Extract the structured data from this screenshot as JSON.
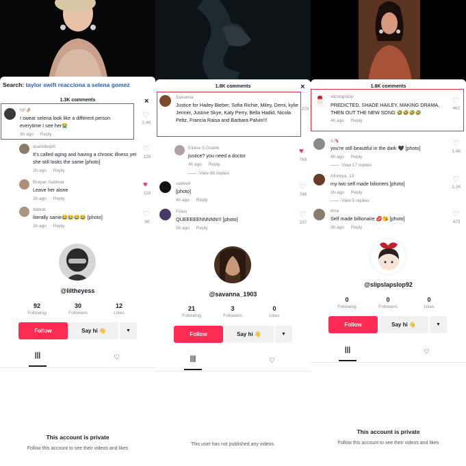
{
  "panels": [
    {
      "search_label": "Search:",
      "search_query": "taylor swift reacciona a selena gomez",
      "comments_header": "1.3K comments",
      "close_icon": "×",
      "comments": [
        {
          "name": "NF🤌🏼",
          "text": "I swear selena look like a different person everytime I see her😭",
          "time": "3h ago",
          "reply": "Reply",
          "likes": "2.4K",
          "liked": false,
          "highlighted": true,
          "avatar_color": "#3a3a3a"
        },
        {
          "name": "acandleqirll",
          "text": "It's called aging and having a chronic illness yet she still looks the same [photo]",
          "time": "2h ago",
          "reply": "Reply",
          "likes": "129",
          "liked": false,
          "avatar_color": "#8a7a6a"
        },
        {
          "name": "Brayan Saldivar",
          "text": "Leave her alone",
          "time": "3h ago",
          "reply": "Reply",
          "likes": "118",
          "liked": true,
          "avatar_color": "#b08f7a"
        },
        {
          "name": "dabrat",
          "text": "literally same😂😂😂😂 [photo]",
          "time": "3h ago",
          "reply": "Reply",
          "likes": "96",
          "liked": false,
          "avatar_color": "#a99580"
        }
      ],
      "profile": {
        "handle": "@liltheyess",
        "stats": [
          {
            "n": "92",
            "l": "Following"
          },
          {
            "n": "30",
            "l": "Followers"
          },
          {
            "n": "12",
            "l": "Likes"
          }
        ],
        "follow": "Follow",
        "say_hi": "Say hi 👋",
        "more": "▼",
        "tab_grid": "|||",
        "tab_liked": "♡",
        "empty_title": "This account is private",
        "empty_sub": "Follow this account to see their videos and likes"
      }
    },
    {
      "comments_header": "1.8K comments",
      "close_icon": "×",
      "comments": [
        {
          "name": "Savanna",
          "text": "Justice for Hailey Bieber, Sofia Richie, Miley, Demi, kylie Jenner, Justine Skye, Katy Perry, Bella Hadid, Nicola Peltz, Francia Raisa and Barbara Palvin!!!",
          "time": "",
          "reply": "",
          "likes": "270",
          "liked": false,
          "highlighted": true,
          "avatar_color": "#7a4a2a"
        },
        {
          "name": "Eliane.S.Duarte",
          "text": "justice? you need a doctor",
          "time": "4h ago",
          "reply": "Reply",
          "likes": "769",
          "liked": true,
          "avatar_color": "#b0a0a8",
          "view_replies": "View 88 replies"
        },
        {
          "name": "sadewii",
          "text": "[photo]",
          "time": "4h ago",
          "reply": "Reply",
          "likes": "746",
          "liked": false,
          "avatar_color": "#111111"
        },
        {
          "name": "Fideo",
          "text": "QUEEEEENNNNN!!! [photo]",
          "time": "5h ago",
          "reply": "Reply",
          "likes": "237",
          "liked": false,
          "avatar_color": "#4a3a6a"
        }
      ],
      "profile": {
        "handle": "@savanna_1903",
        "stats": [
          {
            "n": "21",
            "l": "Following"
          },
          {
            "n": "3",
            "l": "Followers"
          },
          {
            "n": "0",
            "l": "Likes"
          }
        ],
        "follow": "Follow",
        "say_hi": "Say hi 👋",
        "more": "▼",
        "tab_grid": "|||",
        "tab_liked": "♡",
        "empty_title": "",
        "empty_sub": "This user has not published any videos."
      }
    },
    {
      "comments_header": "1.8K comments",
      "comments": [
        {
          "name": "slipslapslop",
          "text": "PREDICTED. SHADE HAILEY, MAKING DRAMA, THEN OUT THE NEW SONG 🤣🤣🤣🤣",
          "time": "4h ago",
          "reply": "Reply",
          "likes": "462",
          "liked": false,
          "highlighted": true,
          "avatar_color": "#c0202a"
        },
        {
          "name": "A🦄",
          "text": "you're still beautiful in the dark 🖤 [photo]",
          "time": "4h ago",
          "reply": "Reply",
          "likes": "1.4K",
          "liked": false,
          "avatar_color": "#8a8a8a",
          "view_replies": "View 17 replies"
        },
        {
          "name": "Afomiya. 13",
          "text": "my two self made bilioners [photo]",
          "time": "3h ago",
          "reply": "Reply",
          "likes": "1.2K",
          "liked": false,
          "avatar_color": "#6a3a2a",
          "view_replies": "View 5 replies"
        },
        {
          "name": "tima",
          "text": "Self made billionaire 💋😘 [photo]",
          "time": "3h ago",
          "reply": "Reply",
          "likes": "473",
          "liked": false,
          "avatar_color": "#8a7a6a"
        }
      ],
      "profile": {
        "handle": "@slipslapslop92",
        "stats": [
          {
            "n": "0",
            "l": "Following"
          },
          {
            "n": "0",
            "l": "Followers"
          },
          {
            "n": "0",
            "l": "Likes"
          }
        ],
        "follow": "Follow",
        "say_hi": "Say hi 👋",
        "more": "▼",
        "tab_grid": "|||",
        "tab_liked": "♡",
        "empty_title": "This account is private",
        "empty_sub": "Follow this account to see their videos and likes"
      }
    }
  ]
}
